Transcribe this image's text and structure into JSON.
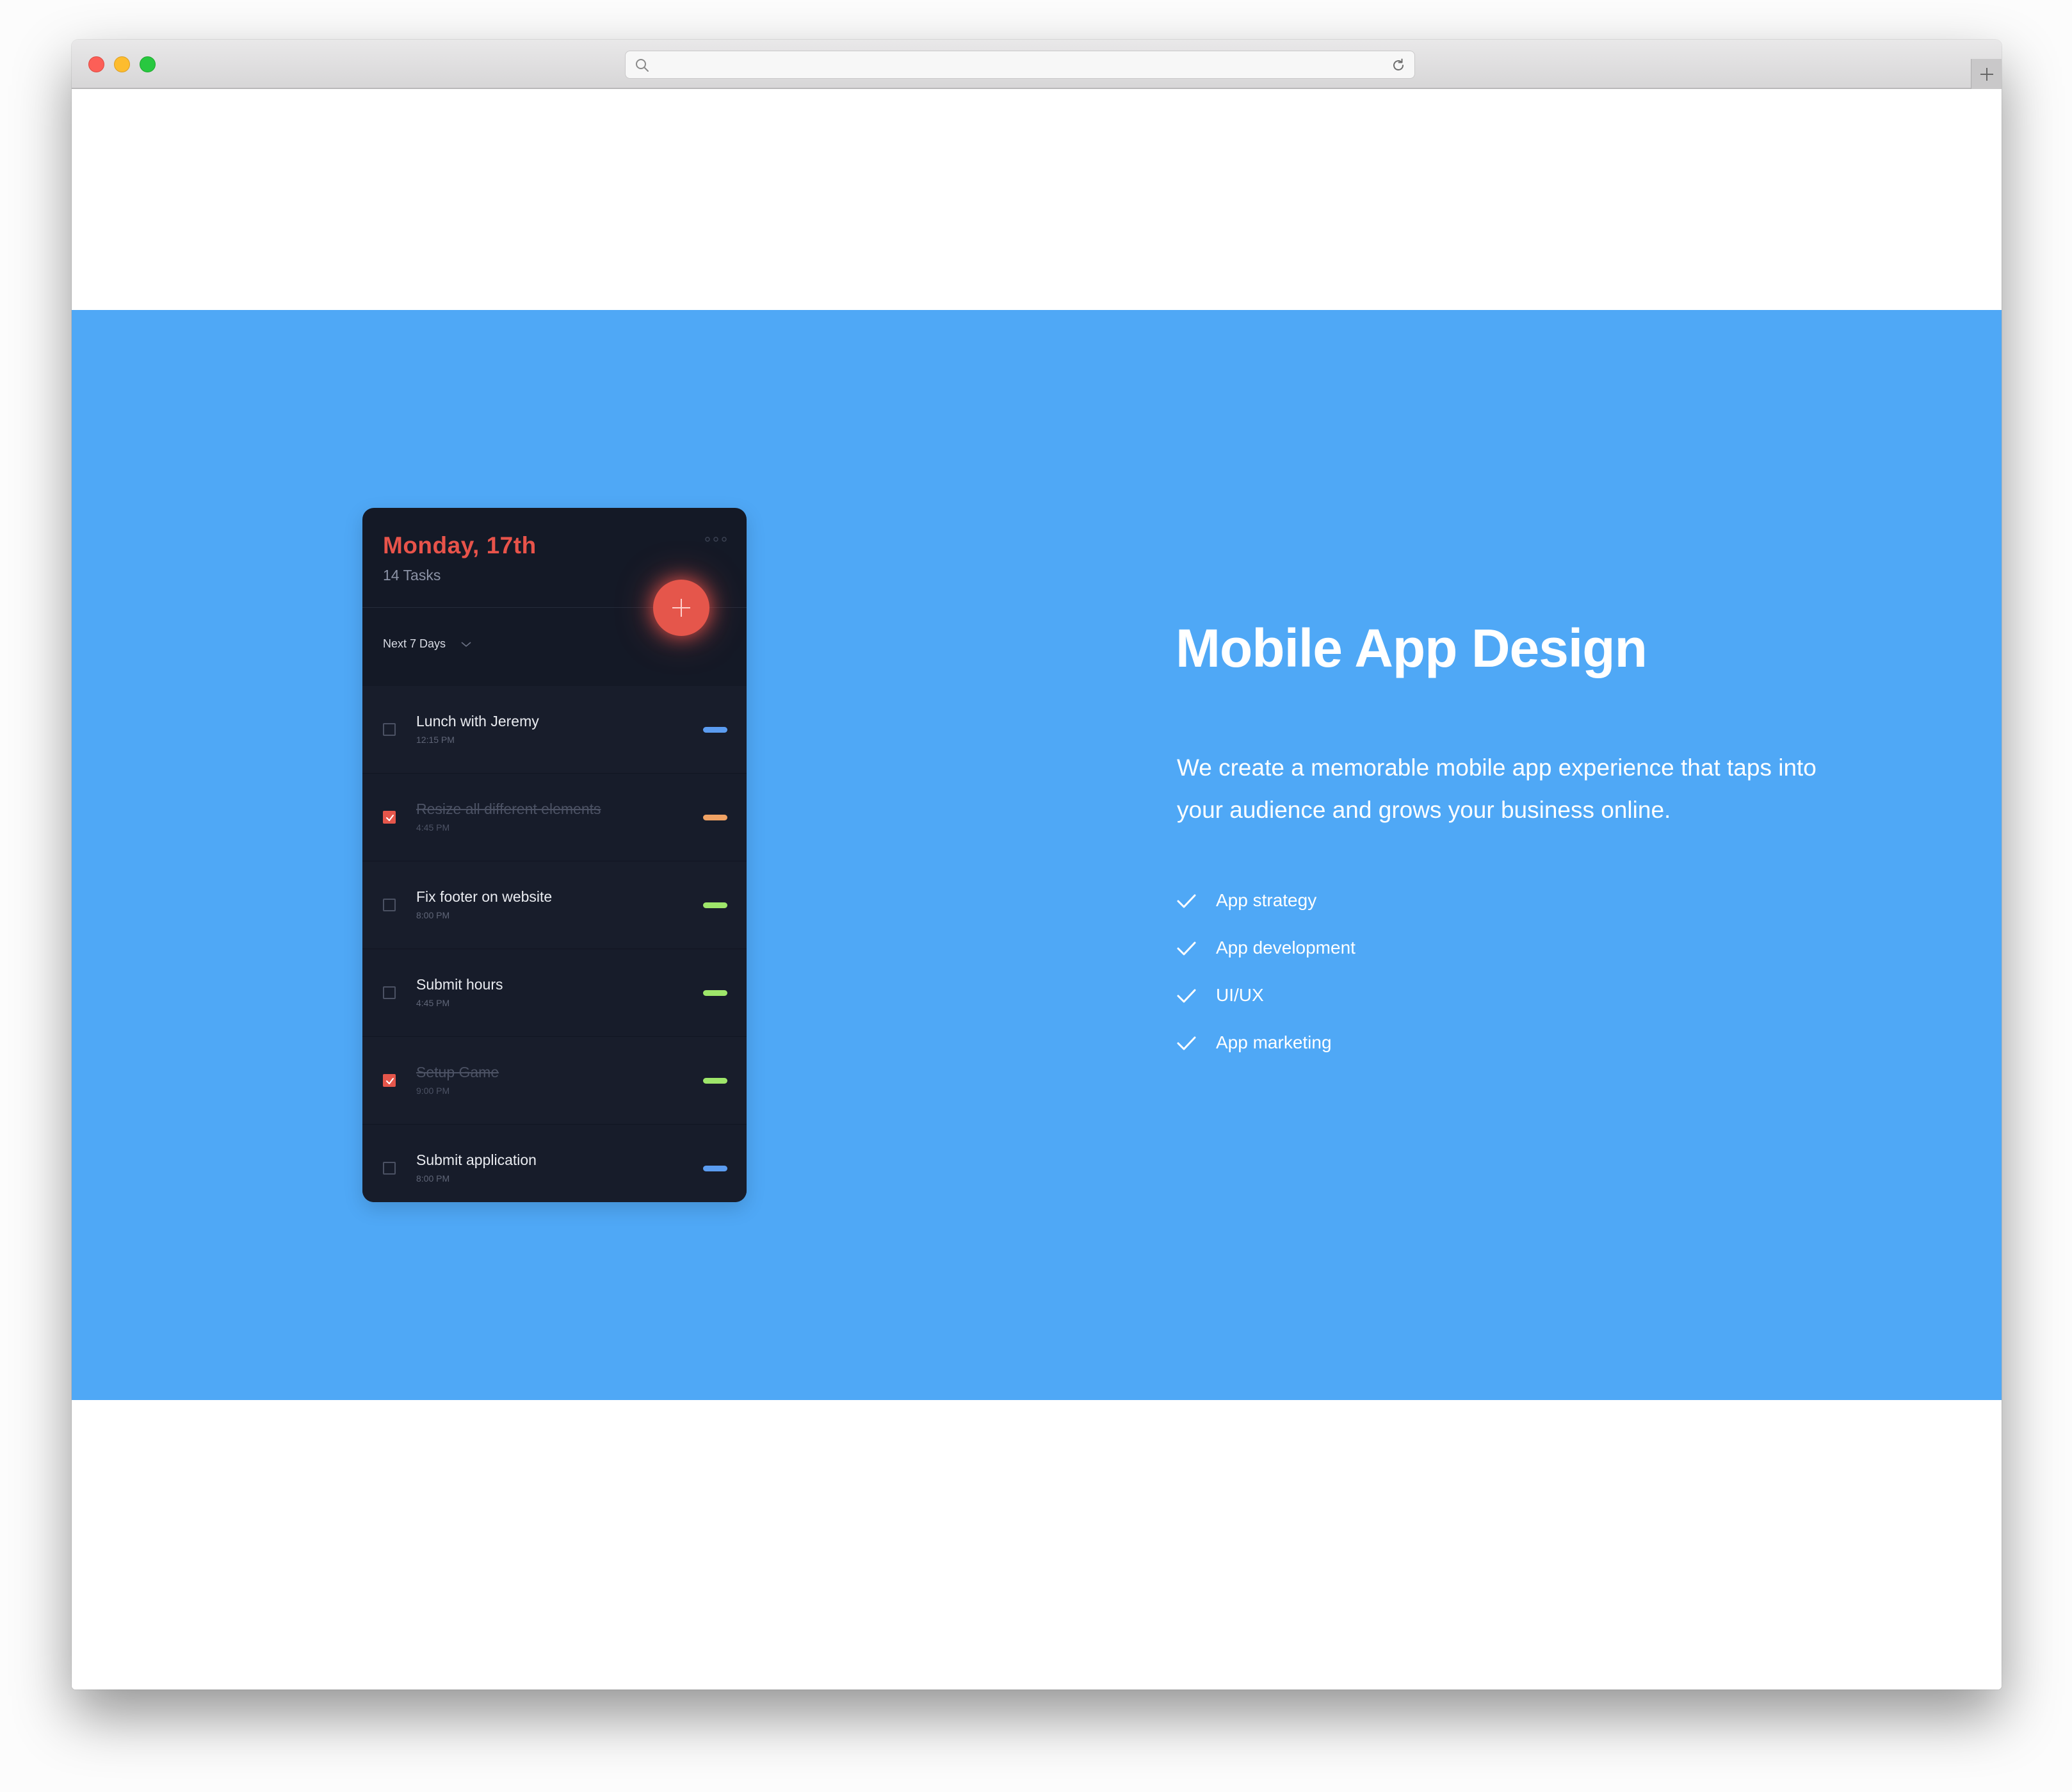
{
  "browser": {
    "url": "",
    "traffic_lights": [
      "close",
      "minimize",
      "zoom"
    ]
  },
  "phone": {
    "date": "Monday, 17th",
    "task_count": "14 Tasks",
    "filter_label": "Next 7 Days",
    "tasks": [
      {
        "title": "Lunch with Jeremy",
        "time": "12:15 PM",
        "done": false,
        "tag_color": "#5b9cf0"
      },
      {
        "title": "Resize all different elements",
        "time": "4:45 PM",
        "done": true,
        "tag_color": "#f0a264"
      },
      {
        "title": "Fix footer on website",
        "time": "8:00 PM",
        "done": false,
        "tag_color": "#9ee66a"
      },
      {
        "title": "Submit hours",
        "time": "4:45 PM",
        "done": false,
        "tag_color": "#9ee66a"
      },
      {
        "title": "Setup Game",
        "time": "9:00 PM",
        "done": true,
        "tag_color": "#9ee66a"
      },
      {
        "title": "Submit application",
        "time": "8:00 PM",
        "done": false,
        "tag_color": "#5b9cf0"
      }
    ]
  },
  "section": {
    "heading": "Mobile App Design",
    "description": "We create a memorable mobile app experience that taps into your audience and grows your business online.",
    "features": [
      "App strategy",
      "App development",
      "UI/UX",
      "App marketing"
    ]
  },
  "colors": {
    "hero_bg": "#4fa8f6",
    "accent": "#e8534a",
    "phone_bg": "#141926"
  }
}
